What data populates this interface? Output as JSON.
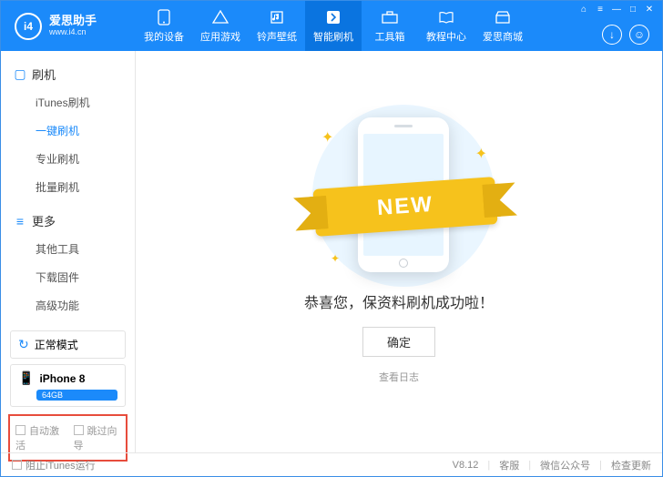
{
  "brand": {
    "name": "爱思助手",
    "url": "www.i4.cn",
    "logo_text": "i4"
  },
  "top_controls": [
    "⌂",
    "≡",
    "—",
    "□",
    "✕"
  ],
  "nav": [
    {
      "label": "我的设备",
      "icon": "phone"
    },
    {
      "label": "应用游戏",
      "icon": "apps"
    },
    {
      "label": "铃声壁纸",
      "icon": "music"
    },
    {
      "label": "智能刷机",
      "icon": "flash",
      "active": true
    },
    {
      "label": "工具箱",
      "icon": "tools"
    },
    {
      "label": "教程中心",
      "icon": "book"
    },
    {
      "label": "爱思商城",
      "icon": "shop"
    }
  ],
  "sidebar": {
    "groups": [
      {
        "title": "刷机",
        "icon": "▢",
        "items": [
          {
            "label": "iTunes刷机"
          },
          {
            "label": "一键刷机",
            "active": true
          },
          {
            "label": "专业刷机"
          },
          {
            "label": "批量刷机"
          }
        ]
      },
      {
        "title": "更多",
        "icon": "≡",
        "items": [
          {
            "label": "其他工具"
          },
          {
            "label": "下载固件"
          },
          {
            "label": "高级功能"
          }
        ]
      }
    ],
    "status": {
      "label": "正常模式",
      "icon": "↻"
    },
    "device": {
      "name": "iPhone 8",
      "storage": "64GB",
      "icon": "📱"
    },
    "options": [
      {
        "label": "自动激活"
      },
      {
        "label": "跳过向导"
      }
    ]
  },
  "main": {
    "ribbon": "NEW",
    "message": "恭喜您，保资料刷机成功啦！",
    "ok": "确定",
    "log": "查看日志"
  },
  "footer": {
    "block_itunes": "阻止iTunes运行",
    "version": "V8.12",
    "links": [
      "客服",
      "微信公众号",
      "检查更新"
    ]
  }
}
